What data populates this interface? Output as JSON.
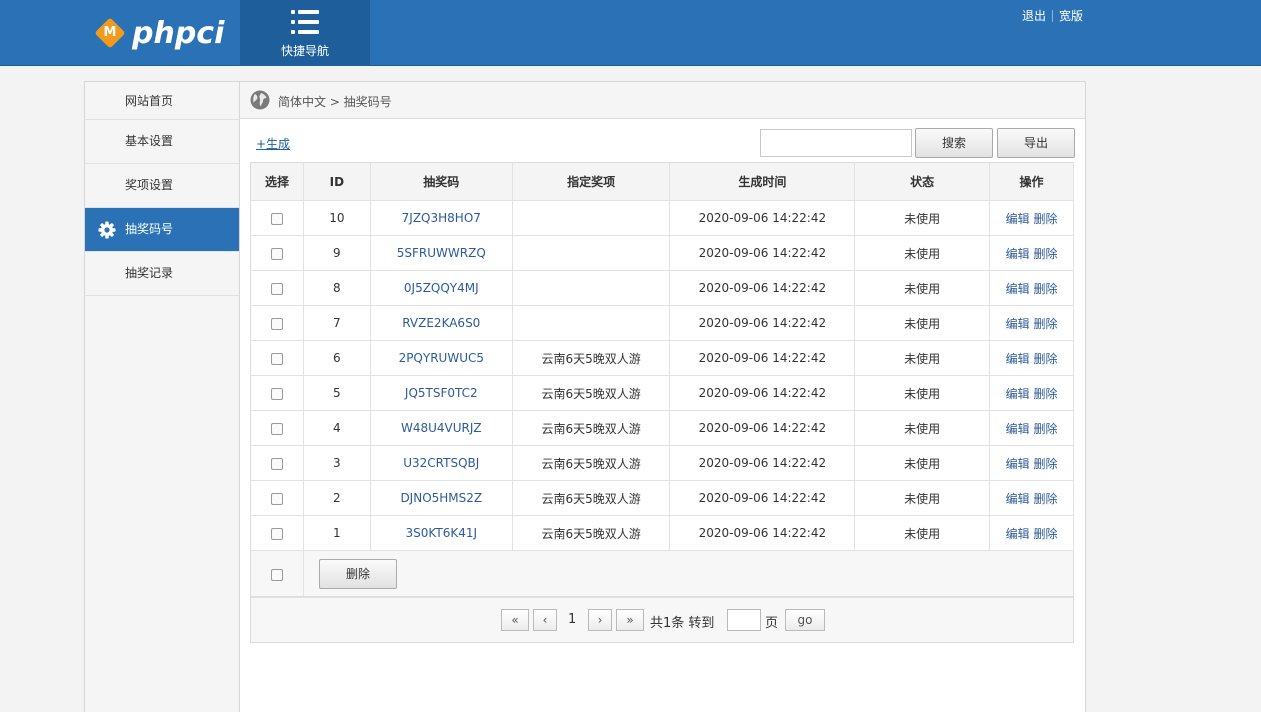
{
  "header": {
    "logo_letter": "M",
    "logo_text": "phpci",
    "quick_nav_label": "快捷导航",
    "logout_label": "退出",
    "wide_label": "宽版"
  },
  "sidebar": {
    "items": [
      {
        "label": "网站首页"
      },
      {
        "label": "基本设置"
      },
      {
        "label": "奖项设置"
      },
      {
        "label": "抽奖码号"
      },
      {
        "label": "抽奖记录"
      }
    ]
  },
  "breadcrumb": "简体中文 > 抽奖码号",
  "toolbar": {
    "generate_label": "+生成",
    "search_value": "",
    "search_label": "搜索",
    "export_label": "导出"
  },
  "table": {
    "headers": [
      "选择",
      "ID",
      "抽奖码",
      "指定奖项",
      "生成时间",
      "状态",
      "操作"
    ],
    "edit_label": "编辑",
    "delete_label": "删除",
    "rows": [
      {
        "id": "10",
        "code": "7JZQ3H8HO7",
        "prize": "",
        "time": "2020-09-06 14:22:42",
        "status": "未使用"
      },
      {
        "id": "9",
        "code": "5SFRUWWRZQ",
        "prize": "",
        "time": "2020-09-06 14:22:42",
        "status": "未使用"
      },
      {
        "id": "8",
        "code": "0J5ZQQY4MJ",
        "prize": "",
        "time": "2020-09-06 14:22:42",
        "status": "未使用"
      },
      {
        "id": "7",
        "code": "RVZE2KA6S0",
        "prize": "",
        "time": "2020-09-06 14:22:42",
        "status": "未使用"
      },
      {
        "id": "6",
        "code": "2PQYRUWUC5",
        "prize": "云南6天5晚双人游",
        "time": "2020-09-06 14:22:42",
        "status": "未使用"
      },
      {
        "id": "5",
        "code": "JQ5TSF0TC2",
        "prize": "云南6天5晚双人游",
        "time": "2020-09-06 14:22:42",
        "status": "未使用"
      },
      {
        "id": "4",
        "code": "W48U4VURJZ",
        "prize": "云南6天5晚双人游",
        "time": "2020-09-06 14:22:42",
        "status": "未使用"
      },
      {
        "id": "3",
        "code": "U32CRTSQBJ",
        "prize": "云南6天5晚双人游",
        "time": "2020-09-06 14:22:42",
        "status": "未使用"
      },
      {
        "id": "2",
        "code": "DJNO5HMS2Z",
        "prize": "云南6天5晚双人游",
        "time": "2020-09-06 14:22:42",
        "status": "未使用"
      },
      {
        "id": "1",
        "code": "3S0KT6K41J",
        "prize": "云南6天5晚双人游",
        "time": "2020-09-06 14:22:42",
        "status": "未使用"
      }
    ],
    "bulk_delete_label": "删除"
  },
  "pager": {
    "first": "«",
    "prev": "‹",
    "current": "1",
    "next": "›",
    "last": "»",
    "total_text": "共1条 转到",
    "page_label": "页",
    "go_label": "go"
  },
  "colors": {
    "header_bg": "#2a72b5",
    "active_sidebar_bg": "#2a72b5",
    "link": "#2c5b9c"
  }
}
